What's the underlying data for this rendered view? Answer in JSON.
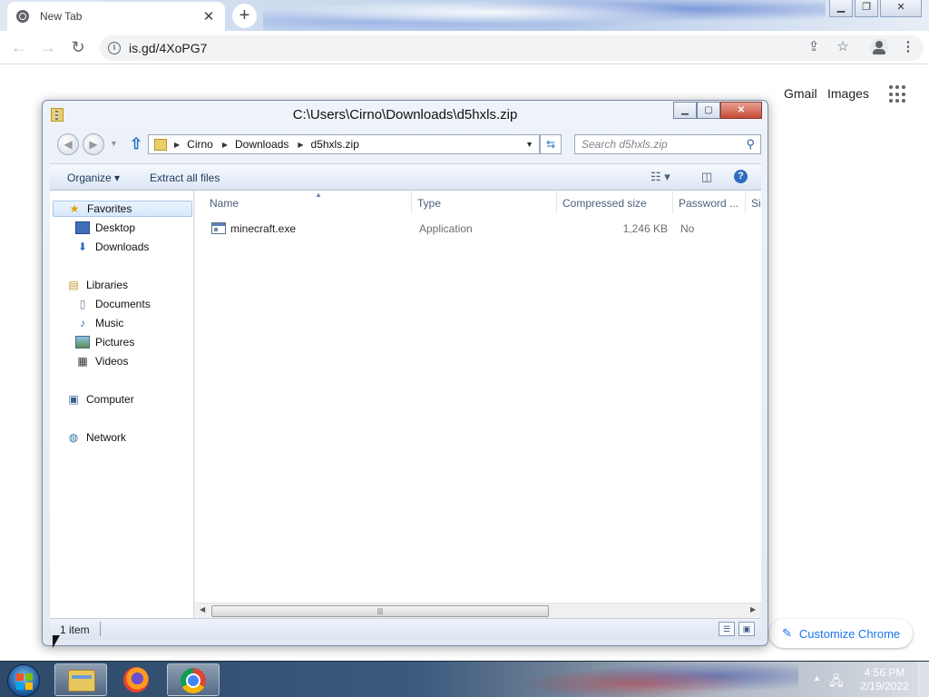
{
  "browser": {
    "tab_title": "New Tab",
    "tab_close": "✕",
    "new_tab": "+",
    "url": "is.gd/4XoPG7",
    "window_controls": {
      "minimize": "▁",
      "restore": "❐",
      "close": "✕"
    },
    "ntp": {
      "gmail": "Gmail",
      "images": "Images",
      "customize": "Customize Chrome"
    }
  },
  "explorer": {
    "title": "C:\\Users\\Cirno\\Downloads\\d5hxls.zip",
    "window_controls": {
      "minimize": "▁",
      "restore": "▢",
      "close": "✕"
    },
    "breadcrumb": [
      "Cirno",
      "Downloads",
      "d5hxls.zip"
    ],
    "search_placeholder": "Search d5hxls.zip",
    "commands": {
      "organize": "Organize ▾",
      "extract": "Extract all files"
    },
    "nav": {
      "favorites": "Favorites",
      "desktop": "Desktop",
      "downloads": "Downloads",
      "libraries": "Libraries",
      "documents": "Documents",
      "music": "Music",
      "pictures": "Pictures",
      "videos": "Videos",
      "computer": "Computer",
      "network": "Network"
    },
    "columns": {
      "name": "Name",
      "type": "Type",
      "compressed": "Compressed size",
      "password": "Password ...",
      "size": "Si"
    },
    "files": [
      {
        "name": "minecraft.exe",
        "type": "Application",
        "compressed": "1,246 KB",
        "password": "No"
      }
    ],
    "status": "1 item"
  },
  "taskbar": {
    "time": "4:56 PM",
    "date": "2/19/2022"
  },
  "colors": {
    "chrome_accent": "#1a73e8",
    "explorer_frame": "#dce6f4",
    "close_red": "#c64a36"
  }
}
